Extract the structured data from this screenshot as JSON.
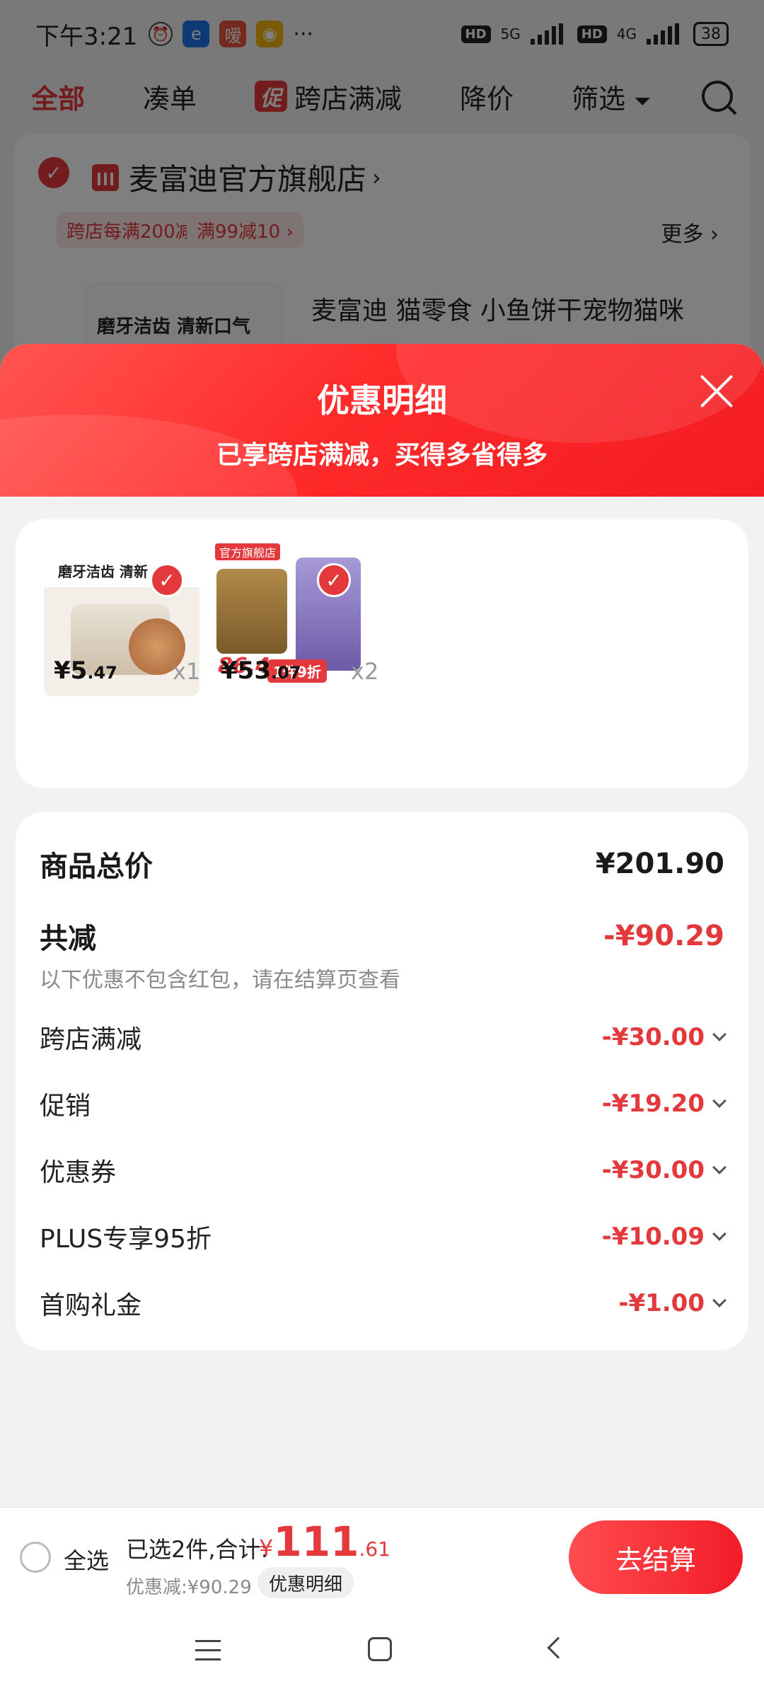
{
  "status_bar": {
    "time": "下午3:21",
    "battery": "38",
    "net1": "5G",
    "net2": "4G",
    "hd": "HD",
    "more": "···"
  },
  "filter_bar": {
    "tabs": [
      "全部",
      "凑单",
      "跨店满减",
      "降价",
      "筛选"
    ],
    "promo_badge": "促"
  },
  "store": {
    "name": "麦富迪官方旗舰店",
    "promo_tags": [
      "跨店每满200减30 ›",
      "满99减10 ›"
    ],
    "more": "更多 ›",
    "thumb_text": "磨牙洁齿 清新口气",
    "product_title": "麦富迪 猫零食 小鱼饼干宠物猫咪"
  },
  "modal": {
    "title": "优惠明细",
    "subtitle": "已享跨店满减，买得多省得多",
    "items": [
      {
        "price_int": "¥5",
        "price_dec": ".47",
        "qty": "x1",
        "img_text": "磨牙洁齿 清新"
      },
      {
        "price_int": "¥53",
        "price_dec": ".07",
        "qty": "x2",
        "img_badge": "官方旗舰店",
        "img_price": "86.4",
        "img_promo": "1件9折"
      }
    ],
    "summary": {
      "total_label": "商品总价",
      "total_value": "¥201.90",
      "reduce_label": "共减",
      "reduce_value": "-¥90.29",
      "note": "以下优惠不包含红包，请在结算页查看",
      "discounts": [
        {
          "label": "跨店满减",
          "value": "-¥30.00"
        },
        {
          "label": "促销",
          "value": "-¥19.20"
        },
        {
          "label": "优惠券",
          "value": "-¥30.00"
        },
        {
          "label": "PLUS专享95折",
          "value": "-¥10.09"
        },
        {
          "label": "首购礼金",
          "value": "-¥1.00"
        }
      ]
    }
  },
  "checkout_bar": {
    "select_all": "全选",
    "selected_text": "已选2件,合计:",
    "currency": "¥",
    "amount_int": "111",
    "amount_dec": ".61",
    "discount_text": "优惠减:¥90.29",
    "detail_button": "优惠明细",
    "checkout_button": "去结算"
  },
  "colors": {
    "accent": "#e4393c",
    "header_gradient_start": "#ff5550",
    "header_gradient_end": "#f21c22"
  }
}
